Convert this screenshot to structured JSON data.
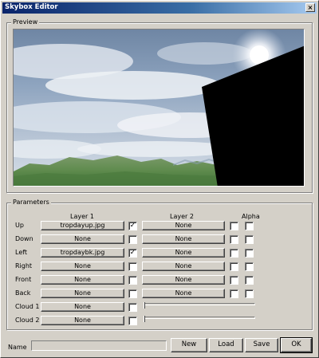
{
  "window": {
    "title": "Skybox Editor",
    "close_glyph": "×"
  },
  "preview": {
    "label": "Preview"
  },
  "parameters": {
    "label": "Parameters",
    "layer1_header": "Layer 1",
    "layer2_header": "Layer 2",
    "alpha_header": "Alpha",
    "rows": [
      {
        "label": "Up",
        "layer1": "tropdayup.jpg",
        "layer1_checked": true,
        "layer2": "None",
        "layer2_checked": false,
        "alpha_checked": false
      },
      {
        "label": "Down",
        "layer1": "None",
        "layer1_checked": false,
        "layer2": "None",
        "layer2_checked": false,
        "alpha_checked": false
      },
      {
        "label": "Left",
        "layer1": "tropdaybk.jpg",
        "layer1_checked": true,
        "layer2": "None",
        "layer2_checked": false,
        "alpha_checked": false
      },
      {
        "label": "Right",
        "layer1": "None",
        "layer1_checked": false,
        "layer2": "None",
        "layer2_checked": false,
        "alpha_checked": false
      },
      {
        "label": "Front",
        "layer1": "None",
        "layer1_checked": false,
        "layer2": "None",
        "layer2_checked": false,
        "alpha_checked": false
      },
      {
        "label": "Back",
        "layer1": "None",
        "layer1_checked": false,
        "layer2": "None",
        "layer2_checked": false,
        "alpha_checked": false
      }
    ],
    "clouds": [
      {
        "label": "Cloud 1",
        "layer1": "None",
        "layer1_checked": false,
        "slider_value": 0
      },
      {
        "label": "Cloud 2",
        "layer1": "None",
        "layer1_checked": false,
        "slider_value": 0
      }
    ]
  },
  "footer": {
    "name_label": "Name",
    "name_value": "",
    "new_label": "New",
    "load_label": "Load",
    "save_label": "Save",
    "ok_label": "OK"
  },
  "check_glyph": "✓"
}
